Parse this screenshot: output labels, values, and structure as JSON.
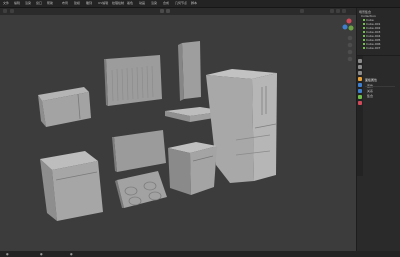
{
  "menubar": {
    "items": [
      "文件",
      "编辑",
      "渲染",
      "窗口",
      "帮助",
      "布局",
      "建模",
      "雕刻",
      "UV编辑",
      "纹理绘制",
      "着色",
      "动画",
      "渲染",
      "合成",
      "几何节点",
      "脚本"
    ]
  },
  "outliner": {
    "rows": [
      "场景集合",
      "Collection",
      "Cube",
      "Cube.001",
      "Cube.002",
      "Cube.003",
      "Cube.004",
      "Cube.005",
      "Cube.006",
      "Cube.007"
    ]
  },
  "properties": {
    "section_title": "面板属性",
    "row1": "变换",
    "row2": "关系",
    "row3": "集合"
  },
  "colors": {
    "viewport_bg": "#3c3c3c",
    "model_light": "#b3b3b3",
    "model_mid": "#9a9a9a",
    "model_dark": "#787878",
    "accent_orange": "#e8a33a",
    "accent_green": "#6fbf4a"
  },
  "icons": [
    "gizmo-axis-icon",
    "zoom-icon",
    "pan-icon",
    "camera-icon",
    "grid-icon"
  ]
}
